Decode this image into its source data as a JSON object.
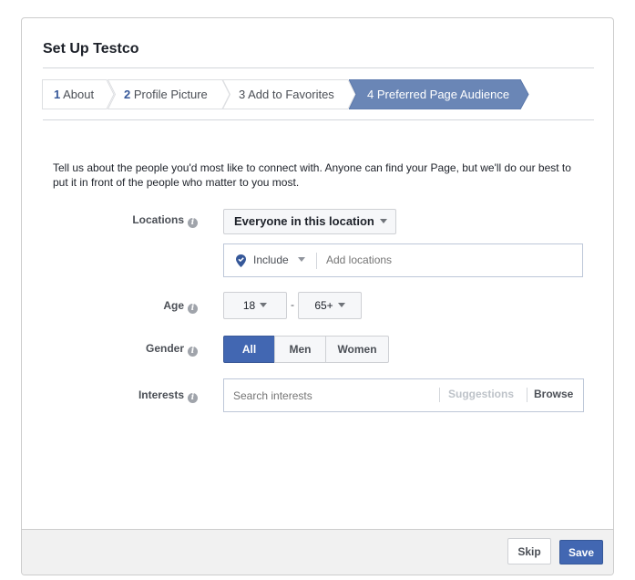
{
  "dialog": {
    "title": "Set Up Testco"
  },
  "steps": [
    {
      "number": "1",
      "label": "About",
      "state": "completed"
    },
    {
      "number": "2",
      "label": "Profile Picture",
      "state": "completed"
    },
    {
      "number": "3",
      "label": "Add to Favorites",
      "state": "pending"
    },
    {
      "number": "4",
      "label": "Preferred Page Audience",
      "state": "active"
    }
  ],
  "colors": {
    "active_step": "#6a86b6",
    "accent": "#4267b2",
    "step_border": "#dddfe2"
  },
  "intro_text": "Tell us about the people you'd most like to connect with. Anyone can find your Page, but we'll do our best to put it in front of the people who matter to you most.",
  "form": {
    "locations": {
      "label": "Locations",
      "info_icon": "info-icon",
      "dropdown_value": "Everyone in this location",
      "include_value": "Include",
      "include_icon": "location-pin-check-icon",
      "input_placeholder": "Add locations",
      "input_value": ""
    },
    "age": {
      "label": "Age",
      "min": "18",
      "separator": "-",
      "max": "65+"
    },
    "gender": {
      "label": "Gender",
      "options": [
        "All",
        "Men",
        "Women"
      ],
      "selected": "All"
    },
    "interests": {
      "label": "Interests",
      "input_placeholder": "Search interests",
      "input_value": "",
      "suggestions_label": "Suggestions",
      "browse_label": "Browse"
    }
  },
  "footer": {
    "skip_label": "Skip",
    "save_label": "Save"
  }
}
